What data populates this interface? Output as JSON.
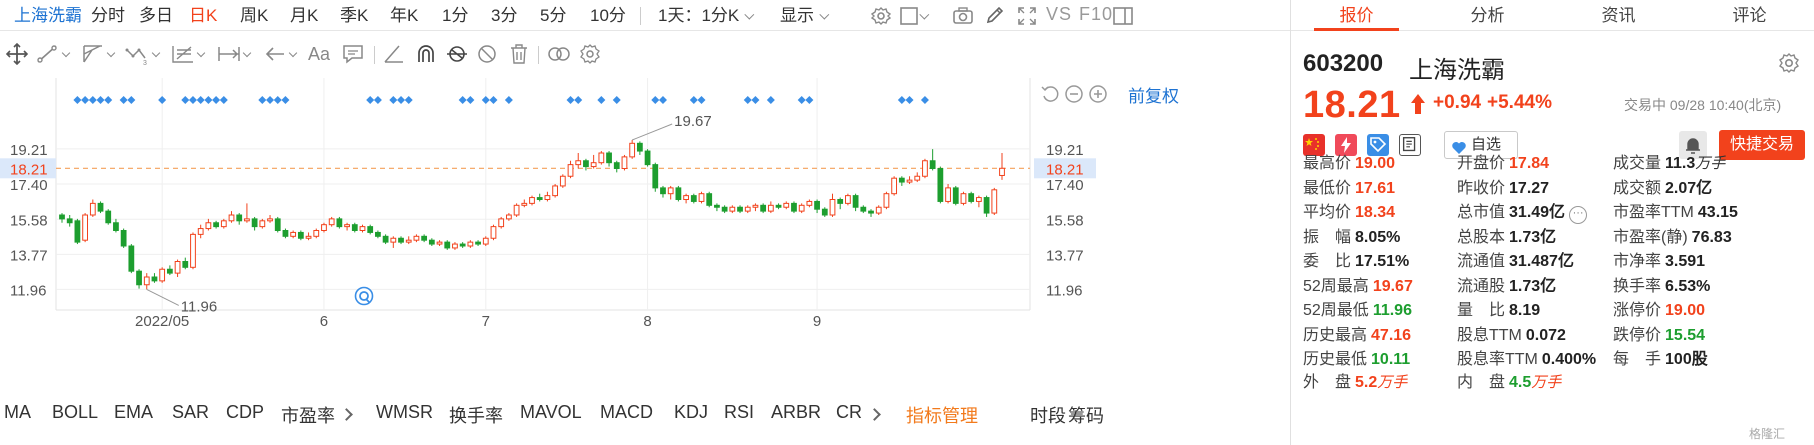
{
  "topbar": {
    "name": "上海洗霸",
    "periods": [
      "分时",
      "多日",
      "日K",
      "周K",
      "月K",
      "季K",
      "年K",
      "1分",
      "3分",
      "5分",
      "10分"
    ],
    "active_period": "日K",
    "range_select": "1天：1分K",
    "display_label": "显示",
    "vs": "VS",
    "f10": "F10"
  },
  "chart": {
    "fuquan": "前复权",
    "y_ticks_left": [
      "19.21",
      "17.40",
      "15.58",
      "13.77",
      "11.96"
    ],
    "y_ticks_right": [
      "19.21",
      "17.40",
      "15.58",
      "13.77",
      "11.96"
    ],
    "current_price_tag": "18.21",
    "max_label": "19.67",
    "min_label": "11.96",
    "x_labels": [
      "2022/05",
      "6",
      "7",
      "8",
      "9"
    ]
  },
  "chart_data": {
    "type": "candlestick",
    "ylim": [
      11.0,
      20.6
    ],
    "reference_line": 18.21,
    "high_label": 19.67,
    "low_label": 11.96,
    "candles": [
      [
        15.8,
        15.6,
        15.9,
        15.4
      ],
      [
        15.6,
        15.4,
        15.8,
        15.2
      ],
      [
        15.5,
        14.4,
        15.6,
        14.3
      ],
      [
        14.5,
        15.8,
        15.9,
        14.4
      ],
      [
        15.8,
        16.4,
        16.6,
        15.7
      ],
      [
        16.4,
        16.0,
        16.5,
        15.9
      ],
      [
        16.0,
        15.4,
        16.1,
        15.3
      ],
      [
        15.4,
        15.0,
        15.6,
        14.9
      ],
      [
        15.0,
        14.2,
        15.1,
        14.1
      ],
      [
        14.2,
        12.9,
        14.3,
        12.8
      ],
      [
        12.9,
        12.2,
        13.0,
        12.0
      ],
      [
        12.2,
        12.6,
        12.8,
        11.96
      ],
      [
        12.6,
        12.4,
        12.8,
        12.3
      ],
      [
        12.4,
        13.0,
        13.1,
        12.3
      ],
      [
        13.0,
        12.8,
        13.2,
        12.7
      ],
      [
        12.8,
        13.4,
        13.5,
        12.6
      ],
      [
        13.4,
        13.1,
        13.6,
        13.0
      ],
      [
        13.1,
        14.8,
        14.9,
        13.0
      ],
      [
        14.8,
        15.1,
        15.3,
        14.6
      ],
      [
        15.1,
        15.4,
        15.6,
        15.0
      ],
      [
        15.4,
        15.2,
        15.5,
        15.1
      ],
      [
        15.2,
        15.5,
        15.6,
        15.1
      ],
      [
        15.5,
        15.8,
        16.0,
        15.4
      ],
      [
        15.8,
        15.5,
        15.9,
        15.3
      ],
      [
        15.5,
        15.6,
        16.4,
        15.4
      ],
      [
        15.6,
        15.2,
        15.7,
        15.0
      ],
      [
        15.2,
        15.5,
        15.6,
        15.1
      ],
      [
        15.5,
        15.6,
        15.8,
        15.4
      ],
      [
        15.6,
        15.0,
        15.7,
        14.9
      ],
      [
        15.0,
        14.7,
        15.1,
        14.6
      ],
      [
        14.7,
        14.9,
        15.0,
        14.6
      ],
      [
        14.9,
        14.6,
        15.0,
        14.5
      ],
      [
        14.6,
        14.7,
        14.9,
        14.5
      ],
      [
        14.7,
        15.0,
        15.1,
        14.6
      ],
      [
        15.0,
        15.3,
        15.4,
        14.9
      ],
      [
        15.3,
        15.6,
        15.7,
        15.2
      ],
      [
        15.6,
        15.2,
        15.7,
        15.1
      ],
      [
        15.2,
        15.3,
        15.4,
        15.0
      ],
      [
        15.3,
        15.0,
        15.4,
        14.9
      ],
      [
        15.0,
        15.2,
        15.3,
        14.9
      ],
      [
        15.2,
        14.9,
        15.3,
        14.8
      ],
      [
        14.9,
        14.7,
        15.0,
        14.6
      ],
      [
        14.7,
        14.4,
        14.8,
        14.3
      ],
      [
        14.4,
        14.6,
        14.7,
        14.1
      ],
      [
        14.6,
        14.4,
        14.7,
        14.3
      ],
      [
        14.4,
        14.5,
        14.7,
        14.3
      ],
      [
        14.5,
        14.7,
        14.8,
        14.4
      ],
      [
        14.7,
        14.5,
        14.8,
        14.4
      ],
      [
        14.5,
        14.3,
        14.6,
        14.2
      ],
      [
        14.3,
        14.4,
        14.5,
        14.2
      ],
      [
        14.4,
        14.1,
        14.5,
        14.0
      ],
      [
        14.1,
        14.3,
        14.4,
        14.0
      ],
      [
        14.3,
        14.2,
        14.4,
        14.1
      ],
      [
        14.2,
        14.4,
        14.5,
        14.1
      ],
      [
        14.4,
        14.3,
        14.5,
        14.2
      ],
      [
        14.3,
        14.6,
        14.7,
        14.2
      ],
      [
        14.6,
        15.2,
        15.3,
        14.5
      ],
      [
        15.2,
        15.6,
        15.7,
        15.1
      ],
      [
        15.6,
        15.8,
        15.9,
        15.5
      ],
      [
        15.8,
        16.3,
        16.4,
        15.7
      ],
      [
        16.3,
        16.4,
        16.6,
        16.2
      ],
      [
        16.4,
        16.7,
        16.8,
        16.3
      ],
      [
        16.7,
        16.6,
        16.9,
        16.5
      ],
      [
        16.6,
        16.8,
        17.0,
        16.5
      ],
      [
        16.8,
        17.3,
        17.4,
        16.7
      ],
      [
        17.3,
        17.8,
        17.9,
        17.2
      ],
      [
        17.8,
        18.4,
        18.6,
        17.7
      ],
      [
        18.4,
        18.6,
        19.0,
        18.2
      ],
      [
        18.6,
        18.3,
        18.7,
        18.1
      ],
      [
        18.3,
        18.5,
        18.9,
        18.2
      ],
      [
        18.5,
        19.0,
        19.1,
        18.4
      ],
      [
        19.0,
        18.5,
        19.1,
        18.3
      ],
      [
        18.5,
        18.2,
        18.6,
        18.0
      ],
      [
        18.2,
        18.8,
        18.9,
        18.1
      ],
      [
        18.8,
        19.5,
        19.67,
        18.7
      ],
      [
        19.5,
        19.1,
        19.6,
        18.9
      ],
      [
        19.1,
        18.4,
        19.2,
        18.3
      ],
      [
        18.4,
        17.2,
        18.5,
        17.0
      ],
      [
        17.2,
        16.9,
        17.3,
        16.7
      ],
      [
        16.9,
        17.2,
        17.3,
        16.6
      ],
      [
        17.2,
        16.6,
        17.3,
        16.5
      ],
      [
        16.6,
        16.8,
        16.9,
        16.4
      ],
      [
        16.8,
        16.5,
        16.9,
        16.4
      ],
      [
        16.5,
        16.9,
        17.0,
        16.4
      ],
      [
        16.9,
        16.3,
        17.0,
        16.2
      ],
      [
        16.3,
        16.2,
        16.4,
        16.0
      ],
      [
        16.2,
        16.0,
        16.3,
        15.9
      ],
      [
        16.0,
        16.2,
        16.3,
        15.9
      ],
      [
        16.2,
        16.0,
        16.3,
        15.9
      ],
      [
        16.0,
        16.2,
        16.3,
        15.9
      ],
      [
        16.2,
        16.3,
        16.4,
        16.0
      ],
      [
        16.3,
        16.0,
        16.4,
        15.9
      ],
      [
        16.0,
        16.3,
        16.5,
        15.9
      ],
      [
        16.3,
        16.2,
        16.4,
        16.1
      ],
      [
        16.2,
        16.4,
        16.5,
        16.1
      ],
      [
        16.4,
        16.0,
        16.5,
        15.9
      ],
      [
        16.0,
        16.3,
        16.4,
        15.9
      ],
      [
        16.3,
        16.5,
        16.6,
        16.2
      ],
      [
        16.5,
        16.1,
        16.6,
        15.9
      ],
      [
        16.1,
        15.8,
        16.2,
        15.7
      ],
      [
        15.8,
        16.6,
        16.9,
        15.7
      ],
      [
        16.6,
        16.4,
        16.7,
        16.1
      ],
      [
        16.4,
        16.8,
        16.9,
        16.3
      ],
      [
        16.8,
        16.2,
        16.9,
        16.0
      ],
      [
        16.2,
        16.0,
        16.3,
        15.9
      ],
      [
        16.0,
        15.9,
        16.1,
        15.7
      ],
      [
        15.9,
        16.2,
        16.3,
        15.8
      ],
      [
        16.2,
        16.9,
        17.0,
        16.1
      ],
      [
        16.9,
        17.7,
        17.8,
        16.8
      ],
      [
        17.7,
        17.5,
        17.8,
        17.3
      ],
      [
        17.5,
        17.6,
        17.8,
        17.4
      ],
      [
        17.6,
        17.8,
        18.0,
        17.5
      ],
      [
        17.8,
        18.6,
        18.7,
        17.7
      ],
      [
        18.6,
        18.2,
        19.2,
        18.1
      ],
      [
        18.2,
        16.5,
        18.3,
        16.4
      ],
      [
        16.5,
        17.2,
        17.4,
        16.4
      ],
      [
        17.2,
        16.4,
        17.3,
        16.3
      ],
      [
        16.4,
        16.9,
        17.0,
        16.3
      ],
      [
        16.9,
        16.5,
        17.0,
        16.4
      ],
      [
        16.5,
        16.7,
        16.8,
        16.2
      ],
      [
        16.7,
        15.9,
        16.8,
        15.7
      ],
      [
        15.9,
        17.1,
        17.2,
        15.8
      ],
      [
        17.84,
        18.21,
        19.0,
        17.61
      ]
    ]
  },
  "indicators": {
    "items_a": [
      "MA",
      "BOLL",
      "EMA",
      "SAR",
      "CDP",
      "市盈率"
    ],
    "items_b": [
      "WMSR",
      "换手率",
      "MAVOL",
      "MACD",
      "KDJ",
      "RSI",
      "ARBR",
      "CR"
    ],
    "manage": "指标管理",
    "timeshare": "时段",
    "chip": "筹码"
  },
  "panel": {
    "tabs": [
      "报价",
      "分析",
      "资讯",
      "评论"
    ],
    "code": "603200",
    "name": "上海洗霸",
    "price": "18.21",
    "change": "+0.94",
    "change_pct": "+5.44%",
    "status": "交易中 09/28 10:40(北京)",
    "zixuan": "自选",
    "quick_trade": "快捷交易",
    "col1": [
      {
        "label": "最高价",
        "value": "19.00",
        "color": "red"
      },
      {
        "label": "最低价",
        "value": "17.61",
        "color": "red"
      },
      {
        "label": "平均价",
        "value": "18.34",
        "color": "red"
      },
      {
        "label": "振　幅",
        "value": "8.05%",
        "color": "dark"
      },
      {
        "label": "委　比",
        "value": "17.51%",
        "color": "dark"
      },
      {
        "label": "52周最高",
        "value": "19.67",
        "color": "red"
      },
      {
        "label": "52周最低",
        "value": "11.96",
        "color": "green"
      },
      {
        "label": "历史最高",
        "value": "47.16",
        "color": "red"
      },
      {
        "label": "历史最低",
        "value": "10.11",
        "color": "green"
      }
    ],
    "col2": [
      {
        "label": "开盘价",
        "value": "17.84",
        "color": "red"
      },
      {
        "label": "昨收价",
        "value": "17.27",
        "color": "dark"
      },
      {
        "label": "总市值",
        "value": "31.49亿",
        "color": "dark"
      },
      {
        "label": "总股本",
        "value": "1.73亿",
        "color": "dark"
      },
      {
        "label": "流通值",
        "value": "31.487亿",
        "color": "dark"
      },
      {
        "label": "流通股",
        "value": "1.73亿",
        "color": "dark"
      },
      {
        "label": "量　比",
        "value": "8.19",
        "color": "dark"
      },
      {
        "label": "股息TTM",
        "value": "0.072",
        "color": "dark"
      },
      {
        "label": "股息率TTM",
        "value": "0.400%",
        "color": "dark"
      }
    ],
    "col3": [
      {
        "label": "成交量",
        "value": "11.3",
        "unit": "万手",
        "color": "dark"
      },
      {
        "label": "成交额",
        "value": "2.07亿",
        "color": "dark"
      },
      {
        "label": "市盈率TTM",
        "value": "43.15",
        "color": "dark"
      },
      {
        "label": "市盈率(静)",
        "value": "76.83",
        "color": "dark"
      },
      {
        "label": "市净率",
        "value": "3.591",
        "color": "dark"
      },
      {
        "label": "换手率",
        "value": "6.53%",
        "color": "dark"
      },
      {
        "label": "涨停价",
        "value": "19.00",
        "color": "red"
      },
      {
        "label": "跌停价",
        "value": "15.54",
        "color": "green"
      },
      {
        "label": "每　手",
        "value": "100股",
        "color": "dark"
      }
    ],
    "outer": {
      "label": "外　盘",
      "value": "5.2",
      "unit": "万手"
    },
    "inner": {
      "label": "内　盘",
      "value": "4.5",
      "unit": "万手"
    },
    "logo": "格隆汇"
  },
  "colors": {
    "up": "#f2421c",
    "down": "#1d9e2f",
    "link": "#1e73d2",
    "ref_line": "#f5a05a",
    "marker": "#3a8ee6"
  }
}
